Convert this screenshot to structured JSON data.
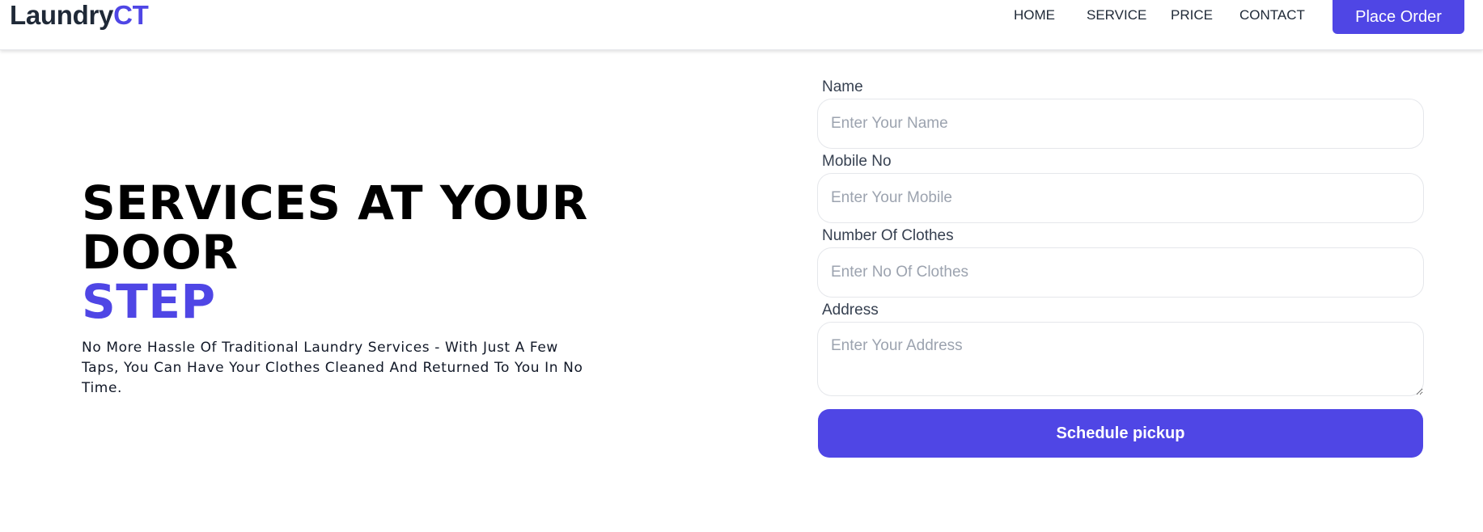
{
  "brand": {
    "name_main": "Laundry",
    "name_accent": "CT",
    "accent_color": "#4f46e5"
  },
  "nav": {
    "items": [
      {
        "label": "HOME"
      },
      {
        "label": "SERVICE"
      },
      {
        "label": "PRICE"
      },
      {
        "label": "CONTACT"
      }
    ],
    "cta_label": "Place Order"
  },
  "hero": {
    "title_main": "SERVICES AT YOUR DOOR",
    "title_accent": "STEP",
    "description": "No More Hassle Of Traditional Laundry Services - With Just A Few Taps, You Can Have Your Clothes Cleaned And Returned To You In No Time."
  },
  "form": {
    "name": {
      "label": "Name",
      "placeholder": "Enter Your Name",
      "value": ""
    },
    "mobile": {
      "label": "Mobile No",
      "placeholder": "Enter Your Mobile",
      "value": ""
    },
    "clothes": {
      "label": "Number Of Clothes",
      "placeholder": "Enter No Of Clothes",
      "value": ""
    },
    "address": {
      "label": "Address",
      "placeholder": "Enter Your Address",
      "value": ""
    },
    "submit_label": "Schedule pickup"
  }
}
